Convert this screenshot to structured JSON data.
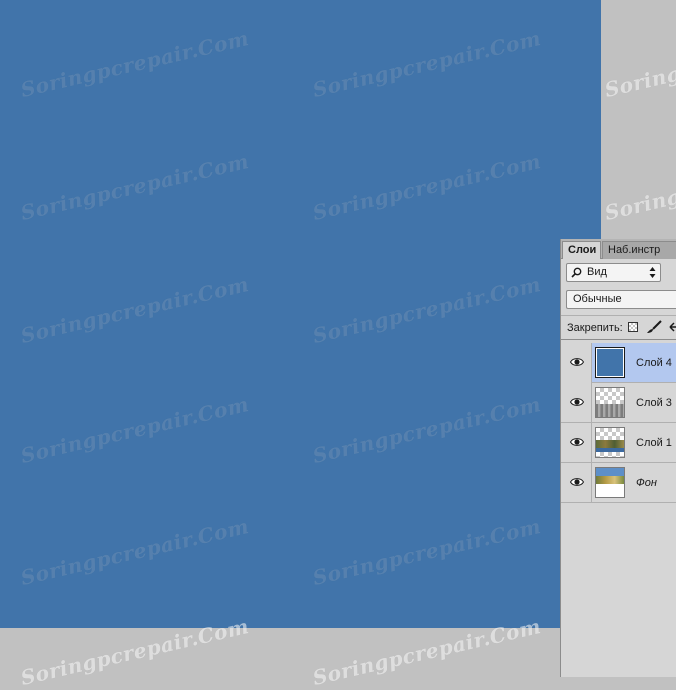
{
  "document": {
    "canvas_color": "#4174aa",
    "workspace_color": "#c1c1c1",
    "watermark_text": "Soringpcrepair.Com"
  },
  "layers_panel": {
    "tabs": [
      {
        "label": "Слои",
        "active": true
      },
      {
        "label": "Наб.инстр",
        "active": false
      }
    ],
    "filter": {
      "label": "Вид",
      "icon": "search-icon"
    },
    "blend_mode": "Обычные",
    "lock": {
      "label": "Закрепить:",
      "icons": [
        "lock-transparent-pixels-icon",
        "lock-image-pixels-icon",
        "lock-position-icon"
      ]
    },
    "layers": [
      {
        "name": "Слой 4",
        "selected": true,
        "visible": true,
        "thumb": "solid-blue"
      },
      {
        "name": "Слой 3",
        "selected": false,
        "visible": true,
        "thumb": "gray-texture"
      },
      {
        "name": "Слой 1",
        "selected": false,
        "visible": true,
        "thumb": "landscape-cutout"
      },
      {
        "name": "Фон",
        "selected": false,
        "visible": true,
        "thumb": "landscape-photo"
      }
    ],
    "selection_color": "#b3c8ef"
  }
}
